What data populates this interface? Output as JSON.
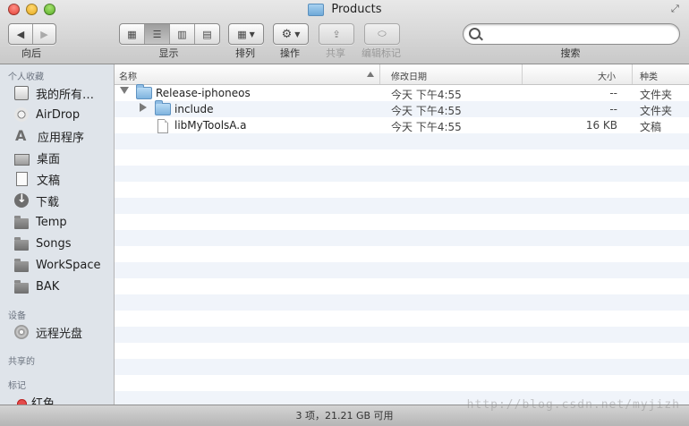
{
  "window": {
    "title": "Products"
  },
  "toolbar": {
    "back_label": "向后",
    "view_label": "显示",
    "arrange_label": "排列",
    "action_label": "操作",
    "share_label": "共享",
    "tags_label": "编辑标记",
    "search_label": "搜索",
    "search_value": ""
  },
  "sidebar": {
    "favorites_header": "个人收藏",
    "favorites": [
      {
        "label": "我的所有…",
        "icon": "all-files-icon"
      },
      {
        "label": "AirDrop",
        "icon": "airdrop-icon"
      },
      {
        "label": "应用程序",
        "icon": "applications-icon"
      },
      {
        "label": "桌面",
        "icon": "desktop-icon"
      },
      {
        "label": "文稿",
        "icon": "documents-icon"
      },
      {
        "label": "下载",
        "icon": "downloads-icon"
      },
      {
        "label": "Temp",
        "icon": "folder-icon"
      },
      {
        "label": "Songs",
        "icon": "folder-icon"
      },
      {
        "label": "WorkSpace",
        "icon": "folder-icon"
      },
      {
        "label": "BAK",
        "icon": "folder-icon"
      }
    ],
    "devices_header": "设备",
    "devices": [
      {
        "label": "远程光盘",
        "icon": "disc-icon"
      }
    ],
    "shared_header": "共享的",
    "tags_header": "标记",
    "tags": [
      {
        "label": "红色",
        "color": "#e34b4b"
      }
    ]
  },
  "columns": {
    "name": "名称",
    "date": "修改日期",
    "size": "大小",
    "kind": "种类"
  },
  "files": [
    {
      "name": "Release-iphoneos",
      "date": "今天 下午4:55",
      "size": "--",
      "kind": "文件夹",
      "icon": "folder-icon",
      "disclosure": "open"
    },
    {
      "name": "include",
      "date": "今天 下午4:55",
      "size": "--",
      "kind": "文件夹",
      "icon": "folder-icon",
      "disclosure": "closed"
    },
    {
      "name": "libMyToolsA.a",
      "date": "今天 下午4:55",
      "size": "16 KB",
      "kind": "文稿",
      "icon": "file-icon",
      "disclosure": ""
    }
  ],
  "status": {
    "text": "3 项，21.21 GB 可用"
  },
  "watermark": "http://blog.csdn.net/myjizh"
}
